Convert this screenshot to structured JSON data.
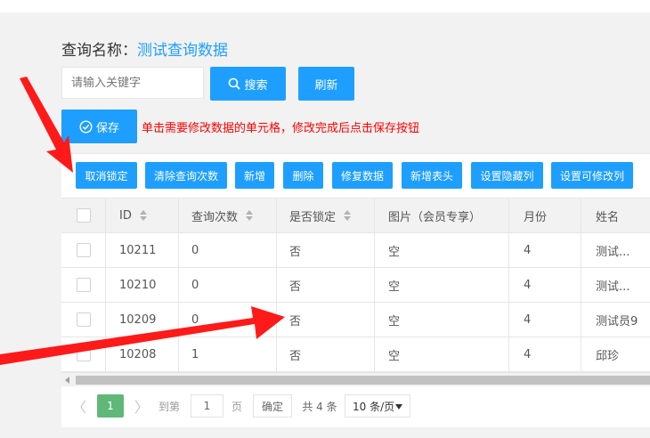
{
  "header": {
    "title_label": "查询名称：",
    "title_value": "测试查询数据"
  },
  "search": {
    "placeholder": "请输入关键字",
    "value": "",
    "search_label": "搜索",
    "refresh_label": "刷新"
  },
  "save": {
    "label": "保存",
    "hint": "单击需要修改数据的单元格，修改完成后点击保存按钮"
  },
  "toolbar": {
    "buttons": [
      "取消锁定",
      "清除查询次数",
      "新增",
      "删除",
      "修复数据",
      "新增表头",
      "设置隐藏列",
      "设置可修改列"
    ]
  },
  "table": {
    "columns": [
      "ID",
      "查询次数",
      "是否锁定",
      "图片（会员专享）",
      "月份",
      "姓名"
    ],
    "rows": [
      [
        "10211",
        "0",
        "否",
        "空",
        "4",
        "测试..."
      ],
      [
        "10210",
        "0",
        "否",
        "空",
        "4",
        "测试..."
      ],
      [
        "10209",
        "0",
        "否",
        "空",
        "4",
        "测试员9"
      ],
      [
        "10208",
        "1",
        "否",
        "空",
        "4",
        "邱珍"
      ]
    ]
  },
  "pager": {
    "prev": "〈",
    "current": "1",
    "next": "〉",
    "goto_label": "到第",
    "goto_value": "1",
    "page_label": "页",
    "confirm_label": "确定",
    "total_label": "共 4 条",
    "page_size": "10 条/页"
  },
  "colors": {
    "primary": "#1e9fff",
    "pager_active": "#5fb878",
    "hint": "#ff0000",
    "arrow": "#ff1a1a"
  },
  "icons": [
    "search-icon",
    "check-circle-icon",
    "caret-down-icon",
    "sort-icon",
    "chevron-left-icon",
    "chevron-right-icon"
  ]
}
